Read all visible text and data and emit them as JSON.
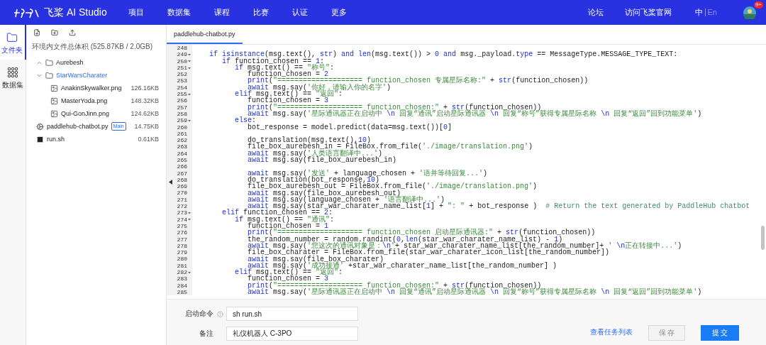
{
  "topbar": {
    "brand": "飞桨 AI Studio",
    "menu": [
      "项目",
      "数据集",
      "课程",
      "比赛",
      "认证",
      "更多"
    ],
    "links": [
      "论坛",
      "访问飞桨官网"
    ],
    "languages": [
      {
        "label": "中",
        "selected": true
      },
      {
        "label": "En",
        "selected": false
      }
    ],
    "badge": "9+"
  },
  "nav": [
    {
      "kind": "folder",
      "label": "文件夹",
      "selected": true
    },
    {
      "kind": "dataset",
      "label": "数据集",
      "selected": false
    }
  ],
  "files": {
    "usage": "环境内文件总体积 (525.87KB / 2.0GB)",
    "tree": [
      {
        "kind": "folder",
        "name": "Aurebesh",
        "expanded": false,
        "selected": false
      },
      {
        "kind": "folder",
        "name": "StarWarsCharater",
        "expanded": true,
        "selected": true,
        "children": [
          {
            "kind": "image",
            "name": "AnakinSkywalker.png",
            "size": "126.16KB"
          },
          {
            "kind": "image",
            "name": "MasterYoda.png",
            "size": "148.32KB"
          },
          {
            "kind": "image",
            "name": "Qui-GonJinn.png",
            "size": "124.62KB"
          }
        ]
      },
      {
        "kind": "python",
        "name": "paddlehub-chatbot.py",
        "badge": "Main",
        "size": "14.75KB"
      },
      {
        "kind": "shell",
        "name": "run.sh",
        "size": "0.61KB"
      }
    ]
  },
  "editor": {
    "tab": "paddlehub-chatbot.py",
    "lines": [
      {
        "no": "248",
        "fold": false
      },
      {
        "no": "249",
        "fold": true,
        "seg": [
          {
            "kind": "kw",
            "text": "   if isinstance"
          },
          {
            "kind": "pl",
            "text": "(msg.text(), "
          },
          {
            "kind": "kw",
            "text": "str"
          },
          {
            "kind": "pl",
            "text": ") "
          },
          {
            "kind": "kw",
            "text": "and len"
          },
          {
            "kind": "pl",
            "text": "(msg.text()) > "
          },
          {
            "kind": "num",
            "text": "0"
          },
          {
            "kind": "kw",
            "text": " and"
          },
          {
            "kind": "pl",
            "text": " msg._payload."
          },
          {
            "kind": "kw",
            "text": "type"
          },
          {
            "kind": "pl",
            "text": " == MessageType.MESSAGE_TYPE_TEXT:"
          }
        ]
      },
      {
        "no": "250",
        "fold": true,
        "seg": [
          {
            "kind": "kw",
            "text": "      if"
          },
          {
            "kind": "pl",
            "text": " function_chosen == "
          },
          {
            "kind": "num",
            "text": "1"
          },
          {
            "kind": "pl",
            "text": ":"
          }
        ]
      },
      {
        "no": "251",
        "fold": true,
        "seg": [
          {
            "kind": "kw",
            "text": "         if"
          },
          {
            "kind": "pl",
            "text": " msg.text() == "
          },
          {
            "kind": "str",
            "text": "\"称号\""
          },
          {
            "kind": "pl",
            "text": ":"
          }
        ]
      },
      {
        "no": "252",
        "fold": false,
        "seg": [
          {
            "kind": "pl",
            "text": "            function_chosen = "
          },
          {
            "kind": "num",
            "text": "2"
          }
        ]
      },
      {
        "no": "253",
        "fold": false,
        "seg": [
          {
            "kind": "kw",
            "text": "            print"
          },
          {
            "kind": "pl",
            "text": "("
          },
          {
            "kind": "str",
            "text": "\"==================== function_chosen 专属星际名称:\""
          },
          {
            "kind": "pl",
            "text": " + "
          },
          {
            "kind": "kw",
            "text": "str"
          },
          {
            "kind": "pl",
            "text": "(function_chosen))"
          }
        ]
      },
      {
        "no": "254",
        "fold": false,
        "seg": [
          {
            "kind": "kw",
            "text": "            await"
          },
          {
            "kind": "pl",
            "text": " msg.say("
          },
          {
            "kind": "str",
            "text": "'你好，请输入你的名字'"
          },
          {
            "kind": "pl",
            "text": ")"
          }
        ]
      },
      {
        "no": "255",
        "fold": true,
        "seg": [
          {
            "kind": "kw",
            "text": "         elif"
          },
          {
            "kind": "pl",
            "text": " msg.text() == "
          },
          {
            "kind": "str",
            "text": "\"返回\""
          },
          {
            "kind": "pl",
            "text": ":"
          }
        ]
      },
      {
        "no": "256",
        "fold": false,
        "seg": [
          {
            "kind": "pl",
            "text": "            function_chosen = "
          },
          {
            "kind": "num",
            "text": "3"
          }
        ]
      },
      {
        "no": "257",
        "fold": false,
        "seg": [
          {
            "kind": "kw",
            "text": "            print"
          },
          {
            "kind": "pl",
            "text": "("
          },
          {
            "kind": "str",
            "text": "\"==================== function_chosen:\""
          },
          {
            "kind": "pl",
            "text": " + "
          },
          {
            "kind": "kw",
            "text": "str"
          },
          {
            "kind": "pl",
            "text": "(function_chosen))"
          }
        ]
      },
      {
        "no": "258",
        "fold": false,
        "seg": [
          {
            "kind": "kw",
            "text": "            await"
          },
          {
            "kind": "pl",
            "text": " msg.say("
          },
          {
            "kind": "str",
            "text": "'星际通讯器正在启动中 "
          },
          {
            "kind": "kw",
            "text": "\\n"
          },
          {
            "kind": "str",
            "text": " 回复“通讯”启动星际通讯器 "
          },
          {
            "kind": "kw",
            "text": "\\n"
          },
          {
            "kind": "str",
            "text": " 回复“称号”获得专属星际名称 "
          },
          {
            "kind": "kw",
            "text": "\\n"
          },
          {
            "kind": "str",
            "text": " 回复“返回”回到功能菜单'"
          },
          {
            "kind": "pl",
            "text": ")"
          }
        ]
      },
      {
        "no": "259",
        "fold": true,
        "seg": [
          {
            "kind": "kw",
            "text": "         else"
          },
          {
            "kind": "pl",
            "text": ":"
          }
        ]
      },
      {
        "no": "260",
        "fold": false,
        "seg": [
          {
            "kind": "pl",
            "text": "            bot_response = model.predict(data=msg.text())["
          },
          {
            "kind": "num",
            "text": "0"
          },
          {
            "kind": "pl",
            "text": "]"
          }
        ]
      },
      {
        "no": "261",
        "fold": false
      },
      {
        "no": "262",
        "fold": false,
        "seg": [
          {
            "kind": "pl",
            "text": "            do_translation(msg.text(),"
          },
          {
            "kind": "num",
            "text": "10"
          },
          {
            "kind": "pl",
            "text": ")"
          }
        ]
      },
      {
        "no": "263",
        "fold": false,
        "seg": [
          {
            "kind": "pl",
            "text": "            file_box_aurebesh_in = FileBox.from_file("
          },
          {
            "kind": "str",
            "text": "'./image/translation.png'"
          },
          {
            "kind": "pl",
            "text": ")"
          }
        ]
      },
      {
        "no": "264",
        "fold": false,
        "seg": [
          {
            "kind": "kw",
            "text": "            await"
          },
          {
            "kind": "pl",
            "text": " msg.say("
          },
          {
            "kind": "str",
            "text": "'人类语言翻译中...'"
          },
          {
            "kind": "pl",
            "text": ")"
          }
        ]
      },
      {
        "no": "265",
        "fold": false,
        "seg": [
          {
            "kind": "kw",
            "text": "            await"
          },
          {
            "kind": "pl",
            "text": " msg.say(file_box_aurebesh_in)"
          }
        ]
      },
      {
        "no": "266",
        "fold": false
      },
      {
        "no": "267",
        "fold": false,
        "seg": [
          {
            "kind": "kw",
            "text": "            await"
          },
          {
            "kind": "pl",
            "text": " msg.say("
          },
          {
            "kind": "str",
            "text": "'发送'"
          },
          {
            "kind": "pl",
            "text": " + language_chosen + "
          },
          {
            "kind": "str",
            "text": "'语并等待回复...'"
          },
          {
            "kind": "pl",
            "text": ")"
          }
        ]
      },
      {
        "no": "268",
        "fold": false,
        "seg": [
          {
            "kind": "pl",
            "text": "            do_translation(bot_response,"
          },
          {
            "kind": "num",
            "text": "10"
          },
          {
            "kind": "pl",
            "text": ")"
          }
        ]
      },
      {
        "no": "269",
        "fold": false,
        "seg": [
          {
            "kind": "pl",
            "text": "            file_box_aurebesh_out = FileBox.from_file("
          },
          {
            "kind": "str",
            "text": "'./image/translation.png'"
          },
          {
            "kind": "pl",
            "text": ")"
          }
        ]
      },
      {
        "no": "270",
        "fold": false,
        "seg": [
          {
            "kind": "kw",
            "text": "            await"
          },
          {
            "kind": "pl",
            "text": " msg.say(file_box_aurebesh_out)"
          }
        ]
      },
      {
        "no": "271",
        "fold": false,
        "seg": [
          {
            "kind": "kw",
            "text": "            await"
          },
          {
            "kind": "pl",
            "text": " msg.say(language_chosen + "
          },
          {
            "kind": "str",
            "text": "'语言翻译中...'"
          },
          {
            "kind": "pl",
            "text": ")"
          }
        ]
      },
      {
        "no": "272",
        "fold": false,
        "seg": [
          {
            "kind": "kw",
            "text": "            await"
          },
          {
            "kind": "pl",
            "text": " msg.say(star_war_charater_name_list["
          },
          {
            "kind": "num",
            "text": "1"
          },
          {
            "kind": "pl",
            "text": "] + "
          },
          {
            "kind": "str",
            "text": "\": \""
          },
          {
            "kind": "pl",
            "text": " + bot_response )  "
          },
          {
            "kind": "cm",
            "text": "# Return the text generated by PaddleHub chatbot"
          }
        ]
      },
      {
        "no": "273",
        "fold": true,
        "seg": [
          {
            "kind": "kw",
            "text": "      elif"
          },
          {
            "kind": "pl",
            "text": " function_chosen == "
          },
          {
            "kind": "num",
            "text": "2"
          },
          {
            "kind": "pl",
            "text": ":"
          }
        ]
      },
      {
        "no": "274",
        "fold": true,
        "seg": [
          {
            "kind": "kw",
            "text": "         if"
          },
          {
            "kind": "pl",
            "text": " msg.text() == "
          },
          {
            "kind": "str",
            "text": "\"通讯\""
          },
          {
            "kind": "pl",
            "text": ":"
          }
        ]
      },
      {
        "no": "275",
        "fold": false,
        "seg": [
          {
            "kind": "pl",
            "text": "            function_chosen = "
          },
          {
            "kind": "num",
            "text": "1"
          }
        ]
      },
      {
        "no": "276",
        "fold": false,
        "seg": [
          {
            "kind": "kw",
            "text": "            print"
          },
          {
            "kind": "pl",
            "text": "("
          },
          {
            "kind": "str",
            "text": "\"==================== function_chosen 启动星际通讯器:\""
          },
          {
            "kind": "pl",
            "text": " + "
          },
          {
            "kind": "kw",
            "text": "str"
          },
          {
            "kind": "pl",
            "text": "(function_chosen))"
          }
        ]
      },
      {
        "no": "277",
        "fold": false,
        "seg": [
          {
            "kind": "pl",
            "text": "            the_random_number = random.randint("
          },
          {
            "kind": "num",
            "text": "0"
          },
          {
            "kind": "pl",
            "text": ","
          },
          {
            "kind": "kw",
            "text": "len"
          },
          {
            "kind": "pl",
            "text": "(star_war_charater_name_list) - "
          },
          {
            "kind": "num",
            "text": "1"
          },
          {
            "kind": "pl",
            "text": ")"
          }
        ]
      },
      {
        "no": "278",
        "fold": false,
        "seg": [
          {
            "kind": "kw",
            "text": "            await"
          },
          {
            "kind": "pl",
            "text": " msg.say("
          },
          {
            "kind": "str",
            "text": "'您这次的通讯对象是："
          },
          {
            "kind": "kw",
            "text": "\\n"
          },
          {
            "kind": "str",
            "text": "'"
          },
          {
            "kind": "pl",
            "text": "+ star_war_charater_name_list[the_random_number]+ "
          },
          {
            "kind": "str",
            "text": "' "
          },
          {
            "kind": "kw",
            "text": "\\n"
          },
          {
            "kind": "str",
            "text": "正在转接中...'"
          },
          {
            "kind": "pl",
            "text": ")"
          }
        ]
      },
      {
        "no": "279",
        "fold": false,
        "seg": [
          {
            "kind": "pl",
            "text": "            file_box_charater = FileBox.from_file(star_war_charater_icon_list[the_random_number])"
          }
        ]
      },
      {
        "no": "280",
        "fold": false,
        "seg": [
          {
            "kind": "kw",
            "text": "            await"
          },
          {
            "kind": "pl",
            "text": " msg.say(file_box_charater)"
          }
        ]
      },
      {
        "no": "281",
        "fold": false,
        "seg": [
          {
            "kind": "kw",
            "text": "            await"
          },
          {
            "kind": "pl",
            "text": " msg.say("
          },
          {
            "kind": "str",
            "text": "'成功接通'"
          },
          {
            "kind": "pl",
            "text": " +star_war_charater_name_list[the_random_number] )"
          }
        ]
      },
      {
        "no": "282",
        "fold": true,
        "seg": [
          {
            "kind": "kw",
            "text": "         elif"
          },
          {
            "kind": "pl",
            "text": " msg.text() == "
          },
          {
            "kind": "str",
            "text": "\"返回\""
          },
          {
            "kind": "pl",
            "text": ":"
          }
        ]
      },
      {
        "no": "283",
        "fold": false,
        "seg": [
          {
            "kind": "pl",
            "text": "            function_chosen = "
          },
          {
            "kind": "num",
            "text": "3"
          }
        ]
      },
      {
        "no": "284",
        "fold": false,
        "seg": [
          {
            "kind": "kw",
            "text": "            print"
          },
          {
            "kind": "pl",
            "text": "("
          },
          {
            "kind": "str",
            "text": "\"==================== function_chosen:\""
          },
          {
            "kind": "pl",
            "text": " + "
          },
          {
            "kind": "kw",
            "text": "str"
          },
          {
            "kind": "pl",
            "text": "(function_chosen))"
          }
        ]
      },
      {
        "no": "285",
        "fold": false,
        "seg": [
          {
            "kind": "kw",
            "text": "            await"
          },
          {
            "kind": "pl",
            "text": " msg.say("
          },
          {
            "kind": "str",
            "text": "'星际通讯器正在启动中 "
          },
          {
            "kind": "kw",
            "text": "\\n"
          },
          {
            "kind": "str",
            "text": " 回复“通讯”启动星际通讯器 "
          },
          {
            "kind": "kw",
            "text": "\\n"
          },
          {
            "kind": "str",
            "text": " 回复“称号”获得专属星际名称 "
          },
          {
            "kind": "kw",
            "text": "\\n"
          },
          {
            "kind": "str",
            "text": " 回复“返回”回到功能菜单'"
          },
          {
            "kind": "pl",
            "text": ")"
          }
        ]
      }
    ]
  },
  "form": {
    "fields": [
      {
        "label": "启动命令",
        "help": true,
        "value": "sh run.sh"
      },
      {
        "label": "备注",
        "help": false,
        "value": "礼仪机器人 C-3PO"
      }
    ],
    "link": "查看任务列表",
    "buttons": [
      {
        "label": "保 存",
        "kind": "default",
        "disabled": true
      },
      {
        "label": "提 交",
        "kind": "primary",
        "disabled": false
      }
    ]
  }
}
